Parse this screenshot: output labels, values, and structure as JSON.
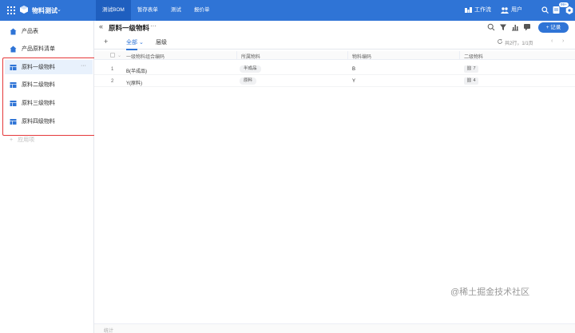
{
  "topbar": {
    "app_name": "物料测试",
    "nav": [
      "测试BOM",
      "暂存表单",
      "测试",
      "报价单"
    ],
    "workflow": "工作流",
    "users": "用户",
    "badge": "99+"
  },
  "sidebar": {
    "items": [
      {
        "label": "产品表"
      },
      {
        "label": "产品原料清单"
      },
      {
        "label": "原料一级物料",
        "more": "···"
      },
      {
        "label": "原料二级物料"
      },
      {
        "label": "原料三级物料"
      },
      {
        "label": "原料四级物料"
      }
    ],
    "add_app": "应用项"
  },
  "main": {
    "title": "原料一级物料",
    "title_more": "···",
    "record_button": "+ 记录",
    "views": [
      "全部",
      "层级"
    ],
    "count": "共2行，1/1页",
    "columns": [
      "一级物料组合编码",
      "所属物料",
      "物料编码",
      "二级物料"
    ],
    "rows": [
      {
        "no": "1",
        "code": "B(半成品)",
        "owner": "半成品",
        "material": "B",
        "sub": "7"
      },
      {
        "no": "2",
        "code": "Y(原料)",
        "owner": "原料",
        "material": "Y",
        "sub": "4"
      }
    ],
    "footer": "统计"
  },
  "watermark": "@稀土掘金技术社区",
  "colors": {
    "primary": "#2f74d6",
    "highlight": "#e5383b"
  }
}
